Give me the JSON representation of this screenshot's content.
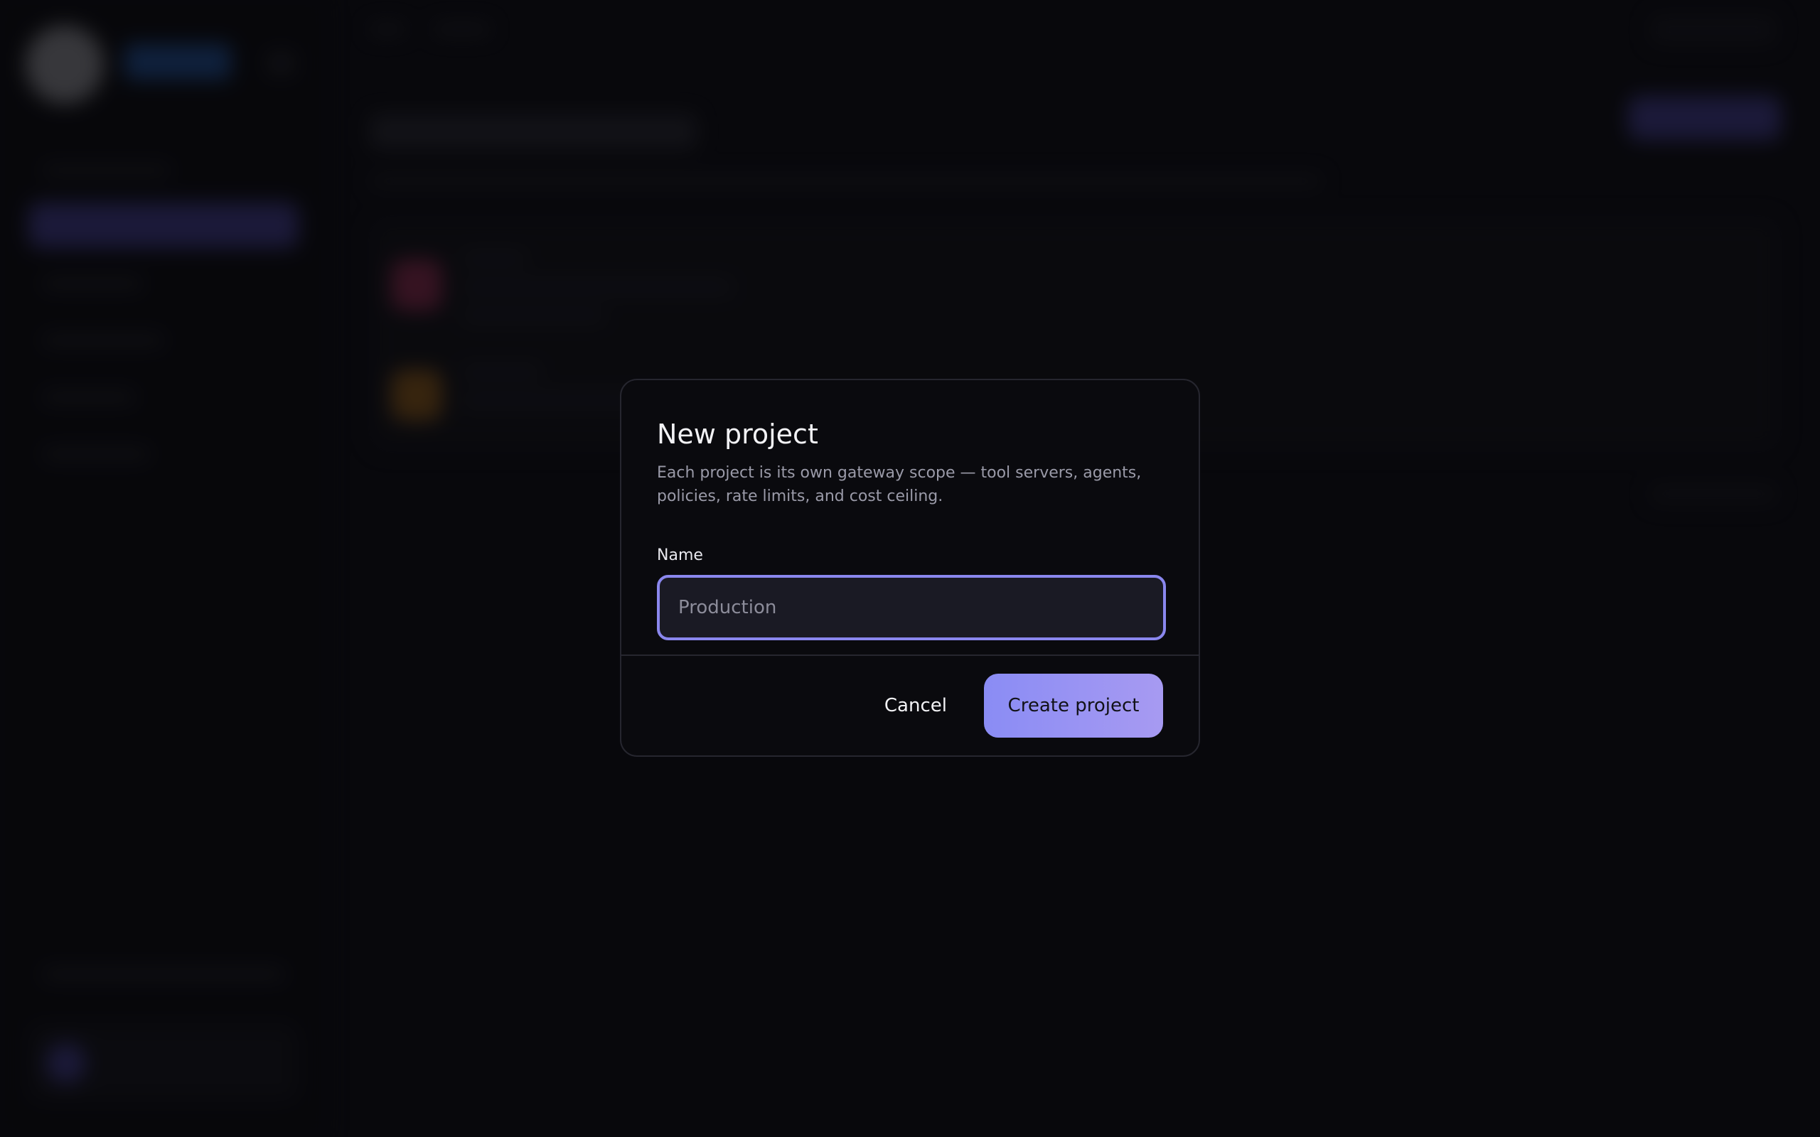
{
  "dialog": {
    "title": "New project",
    "description": "Each project is its own gateway scope — tool servers, agents, policies, rate limits, and cost ceiling.",
    "name_label": "Name",
    "name_value": "",
    "name_placeholder": "Production",
    "cancel_label": "Cancel",
    "create_label": "Create project"
  },
  "colors": {
    "accent": "#8a8cf4",
    "accent_end": "#a79af2",
    "focus_ring": "#8a87ee",
    "dialog_bg": "#0a0a0e"
  }
}
